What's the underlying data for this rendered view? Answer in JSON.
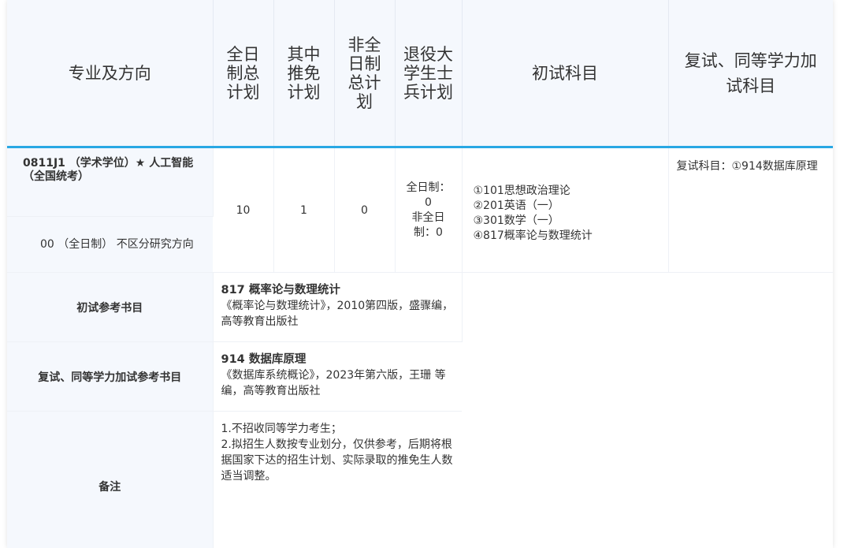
{
  "header": {
    "major": "专业及方向",
    "fulltime_total": "全日制总计划",
    "recommend": "其中推免计划",
    "parttime_total": "非全日制总计划",
    "veteran": "退役大学生士兵计划",
    "initial_subjects": "初试科目",
    "retest_subjects": "复试、同等学力加试科目"
  },
  "program": {
    "major": "0811J1 （学术学位）★ 人工智能（全国统考）",
    "direction": "00 （全日制） 不区分研究方向",
    "fulltime_total": "10",
    "recommend": "1",
    "parttime_total": "0",
    "veteran_line1": "全日制：",
    "veteran_line2": "0",
    "veteran_line3": "非全日",
    "veteran_line4": "制：0",
    "subjects": [
      "①101思想政治理论",
      "②201英语（一）",
      "③301数学（一）",
      "④817概率论与数理统计"
    ],
    "retest": "复试科目：①914数据库原理"
  },
  "initial_books": {
    "label": "初试参考书目",
    "title": "817 概率论与数理统计",
    "detail": "《概率论与数理统计》，2010第四版，盛骤编，高等教育出版社"
  },
  "retest_books": {
    "label": "复试、同等学力加试参考书目",
    "title": "914 数据库原理",
    "detail": "《数据库系统概论》，2023年第六版，王珊 等编，高等教育出版社"
  },
  "notes": {
    "label": "备注",
    "line1": "1.不招收同等学力考生；",
    "line2": "2.拟招生人数按专业划分，仅供参考，后期将根据国家下达的招生计划、实际录取的推免生人数适当调整。"
  }
}
